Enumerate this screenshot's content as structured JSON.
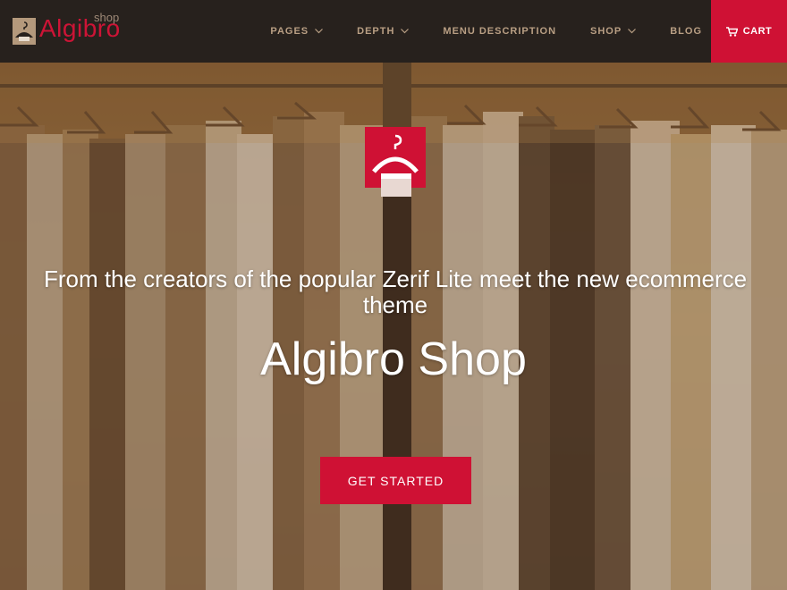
{
  "brand": {
    "name": "Algibro",
    "sub": "shop"
  },
  "nav": {
    "items": [
      {
        "label": "PAGES",
        "has_dropdown": true
      },
      {
        "label": "DEPTH",
        "has_dropdown": true
      },
      {
        "label": "MENU DESCRIPTION",
        "has_dropdown": false
      },
      {
        "label": "SHOP",
        "has_dropdown": true
      },
      {
        "label": "BLOG",
        "has_dropdown": false
      }
    ],
    "cart_label": "CART",
    "cart_icon": "shopping-cart-icon",
    "dropdown_icon": "chevron-down-icon"
  },
  "hero": {
    "icon": "hanger-icon",
    "tagline": "From the creators of the popular Zerif Lite meet the new ecommerce theme",
    "title": "Algibro Shop",
    "button_label": "GET STARTED"
  },
  "colors": {
    "accent": "#cf1134",
    "header_bg": "#27211d",
    "nav_text": "#b99f84"
  }
}
